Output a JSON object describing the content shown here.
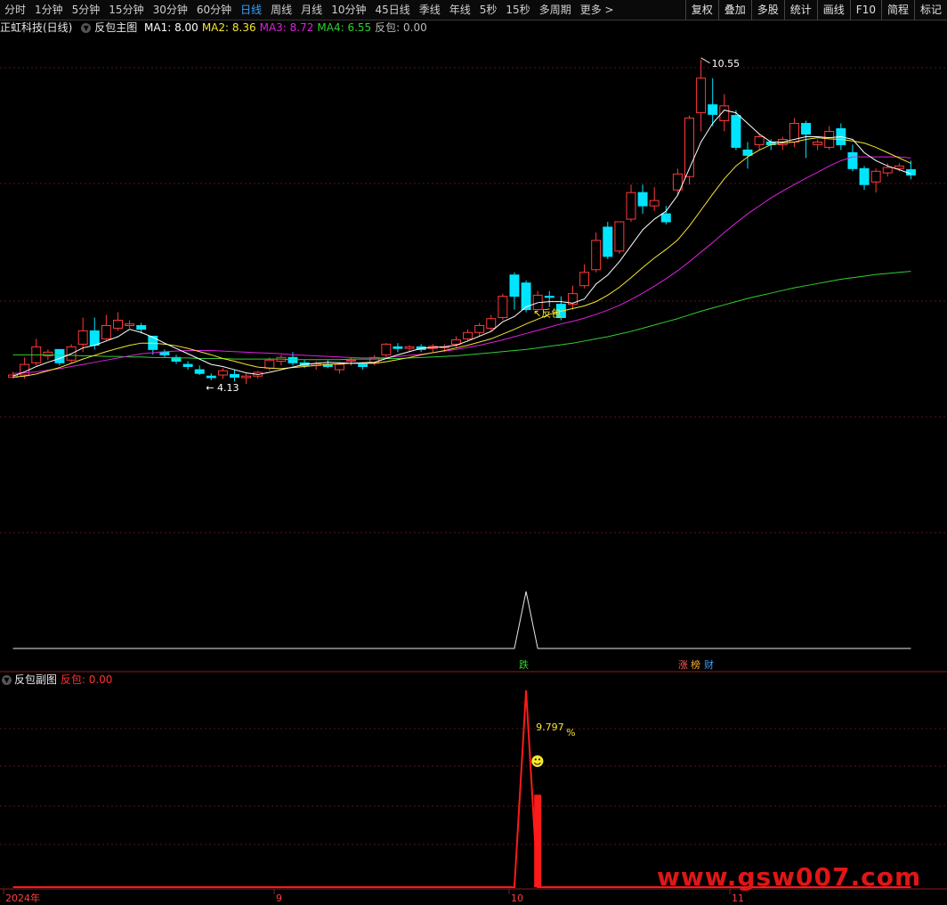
{
  "toolbar": {
    "periods": [
      "分时",
      "1分钟",
      "5分钟",
      "15分钟",
      "30分钟",
      "60分钟",
      "日线",
      "周线",
      "月线",
      "10分钟",
      "45日线",
      "季线",
      "年线",
      "5秒",
      "15秒",
      "多周期",
      "更多 >"
    ],
    "active_period": "日线",
    "tools": [
      "复权",
      "叠加",
      "多股",
      "统计",
      "画线",
      "F10",
      "简程",
      "标记"
    ]
  },
  "main_title": "正虹科技(日线)",
  "main_indicator": "反包主图",
  "ma_values": [
    {
      "label": "MA1: 8.00",
      "color": "#ffffff"
    },
    {
      "label": "MA2: 8.36",
      "color": "#f5e631"
    },
    {
      "label": "MA3: 8.72",
      "color": "#e020e0"
    },
    {
      "label": "MA4: 6.55",
      "color": "#30d030"
    },
    {
      "label": "反包: 0.00",
      "color": "#bbbbbb"
    }
  ],
  "sub_indicator": "反包副图",
  "sub_value": "反包: 0.00",
  "annotations": {
    "high": "10.55",
    "low": "4.13",
    "signal": "反包",
    "pct": "9.797",
    "pct_unit": "%",
    "smiley": "☻"
  },
  "event_markers": [
    "跌",
    "涨",
    "榜",
    "财"
  ],
  "x_axis": [
    "2024年",
    "9",
    "10",
    "11"
  ],
  "watermark": "www.gsw007.com",
  "colors": {
    "up": "#ff3a3a",
    "down": "#00e5ff",
    "ma1": "#ffffff",
    "ma2": "#f5e631",
    "ma3": "#e020e0",
    "ma4": "#30d030",
    "grid": "#5a1414",
    "sub_line": "#ff1a1a"
  },
  "chart_data": {
    "type": "candlestick",
    "title": "正虹科技(日线)",
    "ylim": [
      3.8,
      11.0
    ],
    "candles": [
      [
        4.58,
        4.62,
        4.55,
        4.68
      ],
      [
        4.62,
        4.82,
        4.55,
        4.95
      ],
      [
        4.85,
        5.15,
        4.8,
        5.3
      ],
      [
        4.98,
        5.05,
        4.9,
        5.1
      ],
      [
        5.1,
        4.85,
        4.8,
        5.1
      ],
      [
        4.9,
        5.15,
        4.85,
        5.2
      ],
      [
        5.2,
        5.45,
        5.05,
        5.7
      ],
      [
        5.45,
        5.18,
        5.1,
        5.7
      ],
      [
        5.3,
        5.55,
        5.25,
        5.75
      ],
      [
        5.5,
        5.65,
        5.45,
        5.8
      ],
      [
        5.55,
        5.58,
        5.5,
        5.65
      ],
      [
        5.55,
        5.48,
        5.4,
        5.6
      ],
      [
        5.35,
        5.1,
        5.0,
        5.35
      ],
      [
        5.05,
        5.0,
        4.95,
        5.1
      ],
      [
        4.95,
        4.88,
        4.83,
        5.0
      ],
      [
        4.82,
        4.78,
        4.72,
        4.88
      ],
      [
        4.72,
        4.65,
        4.62,
        4.8
      ],
      [
        4.6,
        4.57,
        4.52,
        4.65
      ],
      [
        4.62,
        4.7,
        4.55,
        4.75
      ],
      [
        4.63,
        4.58,
        4.5,
        4.72
      ],
      [
        4.57,
        4.6,
        4.45,
        4.65
      ],
      [
        4.6,
        4.67,
        4.55,
        4.7
      ],
      [
        4.75,
        4.9,
        4.7,
        4.95
      ],
      [
        4.88,
        4.95,
        4.8,
        5.0
      ],
      [
        4.95,
        4.85,
        4.8,
        5.05
      ],
      [
        4.85,
        4.8,
        4.75,
        4.9
      ],
      [
        4.8,
        4.83,
        4.72,
        4.88
      ],
      [
        4.82,
        4.78,
        4.75,
        4.9
      ],
      [
        4.72,
        4.82,
        4.65,
        4.86
      ],
      [
        4.88,
        4.9,
        4.8,
        4.95
      ],
      [
        4.82,
        4.78,
        4.72,
        4.85
      ],
      [
        4.85,
        4.95,
        4.8,
        5.0
      ],
      [
        5.0,
        5.2,
        4.95,
        5.22
      ],
      [
        5.15,
        5.12,
        5.05,
        5.22
      ],
      [
        5.12,
        5.15,
        5.05,
        5.18
      ],
      [
        5.15,
        5.1,
        5.05,
        5.2
      ],
      [
        5.12,
        5.16,
        5.05,
        5.2
      ],
      [
        5.14,
        5.15,
        5.05,
        5.2
      ],
      [
        5.2,
        5.28,
        5.15,
        5.35
      ],
      [
        5.3,
        5.42,
        5.25,
        5.48
      ],
      [
        5.42,
        5.55,
        5.35,
        5.6
      ],
      [
        5.5,
        5.68,
        5.45,
        5.75
      ],
      [
        5.7,
        6.1,
        5.65,
        6.15
      ],
      [
        6.5,
        6.1,
        5.85,
        6.55
      ],
      [
        6.35,
        5.85,
        5.8,
        6.4
      ],
      [
        5.85,
        6.12,
        5.8,
        6.2
      ],
      [
        6.1,
        6.08,
        5.9,
        6.2
      ],
      [
        5.95,
        5.7,
        5.65,
        6.1
      ],
      [
        5.95,
        6.15,
        5.85,
        6.3
      ],
      [
        6.3,
        6.55,
        6.25,
        6.7
      ],
      [
        6.6,
        7.15,
        6.55,
        7.3
      ],
      [
        7.4,
        6.85,
        6.8,
        7.5
      ],
      [
        6.95,
        7.5,
        6.9,
        7.5
      ],
      [
        7.55,
        8.05,
        7.5,
        8.2
      ],
      [
        8.05,
        7.8,
        7.65,
        8.2
      ],
      [
        7.8,
        7.9,
        7.7,
        8.15
      ],
      [
        7.65,
        7.5,
        7.45,
        7.8
      ],
      [
        8.1,
        8.4,
        8.0,
        8.5
      ],
      [
        8.35,
        9.45,
        8.2,
        9.5
      ],
      [
        9.55,
        10.2,
        9.2,
        10.55
      ],
      [
        9.7,
        9.52,
        9.3,
        10.2
      ],
      [
        9.4,
        9.68,
        9.2,
        9.9
      ],
      [
        9.5,
        8.9,
        8.85,
        9.6
      ],
      [
        8.85,
        8.75,
        8.5,
        9.0
      ],
      [
        8.95,
        9.1,
        8.85,
        9.15
      ],
      [
        9.0,
        8.95,
        8.85,
        9.05
      ],
      [
        8.95,
        9.05,
        8.85,
        9.1
      ],
      [
        9.0,
        9.35,
        8.9,
        9.45
      ],
      [
        9.35,
        9.15,
        8.7,
        9.4
      ],
      [
        8.95,
        9.0,
        8.85,
        9.05
      ],
      [
        8.9,
        9.2,
        8.85,
        9.3
      ],
      [
        9.25,
        8.95,
        8.85,
        9.35
      ],
      [
        8.8,
        8.5,
        8.45,
        8.95
      ],
      [
        8.5,
        8.2,
        8.1,
        8.55
      ],
      [
        8.25,
        8.45,
        8.05,
        8.5
      ],
      [
        8.42,
        8.52,
        8.35,
        8.6
      ],
      [
        8.5,
        8.55,
        8.45,
        8.6
      ],
      [
        8.48,
        8.38,
        8.3,
        8.65
      ]
    ],
    "ma1": [
      4.6,
      4.68,
      4.78,
      4.86,
      4.93,
      5.02,
      5.13,
      5.18,
      5.26,
      5.34,
      5.48,
      5.42,
      5.33,
      5.22,
      5.12,
      5.02,
      4.92,
      4.82,
      4.78,
      4.72,
      4.66,
      4.63,
      4.67,
      4.72,
      4.77,
      4.82,
      4.84,
      4.86,
      4.85,
      4.84,
      4.85,
      4.86,
      4.93,
      5.0,
      5.06,
      5.12,
      5.14,
      5.15,
      5.18,
      5.26,
      5.35,
      5.44,
      5.62,
      5.72,
      5.9,
      5.98,
      6.0,
      6.0,
      5.97,
      6.05,
      6.33,
      6.5,
      6.75,
      7.05,
      7.35,
      7.55,
      7.7,
      8.0,
      8.5,
      9.0,
      9.35,
      9.6,
      9.55,
      9.35,
      9.15,
      9.0,
      9.0,
      9.05,
      9.1,
      9.1,
      9.08,
      9.1,
      9.05,
      8.8,
      8.65,
      8.55,
      8.48,
      8.4
    ],
    "ma2": [
      4.58,
      4.6,
      4.64,
      4.7,
      4.76,
      4.84,
      4.92,
      4.99,
      5.06,
      5.12,
      5.18,
      5.22,
      5.22,
      5.2,
      5.17,
      5.12,
      5.06,
      5.0,
      4.93,
      4.88,
      4.82,
      4.77,
      4.75,
      4.74,
      4.76,
      4.78,
      4.8,
      4.82,
      4.83,
      4.84,
      4.84,
      4.84,
      4.87,
      4.91,
      4.95,
      5.0,
      5.04,
      5.08,
      5.13,
      5.18,
      5.24,
      5.3,
      5.39,
      5.48,
      5.58,
      5.67,
      5.76,
      5.82,
      5.87,
      5.92,
      6.0,
      6.12,
      6.27,
      6.45,
      6.64,
      6.82,
      6.98,
      7.16,
      7.42,
      7.72,
      8.02,
      8.31,
      8.55,
      8.72,
      8.85,
      8.95,
      8.98,
      9.0,
      9.05,
      9.08,
      9.06,
      9.05,
      9.02,
      8.98,
      8.9,
      8.8,
      8.7,
      8.6
    ],
    "ma3": [
      4.65,
      4.66,
      4.68,
      4.71,
      4.74,
      4.78,
      4.82,
      4.86,
      4.9,
      4.94,
      4.98,
      5.02,
      5.04,
      5.06,
      5.07,
      5.08,
      5.08,
      5.08,
      5.07,
      5.06,
      5.05,
      5.04,
      5.03,
      5.02,
      5.0,
      4.99,
      4.98,
      4.97,
      4.96,
      4.95,
      4.94,
      4.94,
      4.95,
      4.97,
      4.99,
      5.01,
      5.04,
      5.07,
      5.1,
      5.14,
      5.18,
      5.23,
      5.28,
      5.34,
      5.4,
      5.46,
      5.52,
      5.58,
      5.63,
      5.69,
      5.76,
      5.84,
      5.93,
      6.04,
      6.16,
      6.29,
      6.43,
      6.58,
      6.75,
      6.93,
      7.11,
      7.3,
      7.48,
      7.65,
      7.8,
      7.95,
      8.08,
      8.2,
      8.32,
      8.43,
      8.55,
      8.65,
      8.72,
      8.72,
      8.72,
      8.72,
      8.72,
      8.7
    ],
    "ma4": [
      5.0,
      5.0,
      5.0,
      5.0,
      4.99,
      4.99,
      4.98,
      4.98,
      4.97,
      4.97,
      4.96,
      4.96,
      4.95,
      4.95,
      4.94,
      4.94,
      4.93,
      4.93,
      4.93,
      4.92,
      4.92,
      4.92,
      4.92,
      4.92,
      4.91,
      4.91,
      4.91,
      4.91,
      4.91,
      4.92,
      4.92,
      4.92,
      4.93,
      4.93,
      4.94,
      4.95,
      4.96,
      4.97,
      4.98,
      5.0,
      5.02,
      5.04,
      5.06,
      5.08,
      5.1,
      5.13,
      5.16,
      5.19,
      5.22,
      5.26,
      5.3,
      5.34,
      5.39,
      5.44,
      5.5,
      5.56,
      5.62,
      5.68,
      5.75,
      5.82,
      5.88,
      5.94,
      6.0,
      6.06,
      6.11,
      6.16,
      6.21,
      6.26,
      6.3,
      6.34,
      6.38,
      6.42,
      6.45,
      6.48,
      6.51,
      6.53,
      6.55,
      6.57
    ],
    "high_label": {
      "index": 59,
      "value": 10.55
    },
    "low_label": {
      "index": 17,
      "value": 4.13
    },
    "signal_index": 44,
    "signal_mid": [
      0,
      0,
      0,
      0,
      0,
      0,
      0,
      0,
      0,
      0,
      0,
      0,
      0,
      0,
      0,
      0,
      0,
      0,
      0,
      0,
      0,
      0,
      0,
      0,
      0,
      0,
      0,
      0,
      0,
      0,
      0,
      0,
      0,
      0,
      0,
      0,
      0,
      0,
      0,
      0,
      0,
      0,
      0,
      0,
      1,
      0,
      0,
      0,
      0,
      0,
      0,
      0,
      0,
      0,
      0,
      0,
      0,
      0,
      0,
      0,
      0,
      0,
      0,
      0,
      0,
      0,
      0,
      0,
      0,
      0,
      0,
      0,
      0,
      0,
      0,
      0,
      0,
      0
    ],
    "sub_series": {
      "name": "反包",
      "peak_index": 44,
      "peak_value": 9.797,
      "bar_index": 45,
      "bar_value": 4.6
    }
  }
}
